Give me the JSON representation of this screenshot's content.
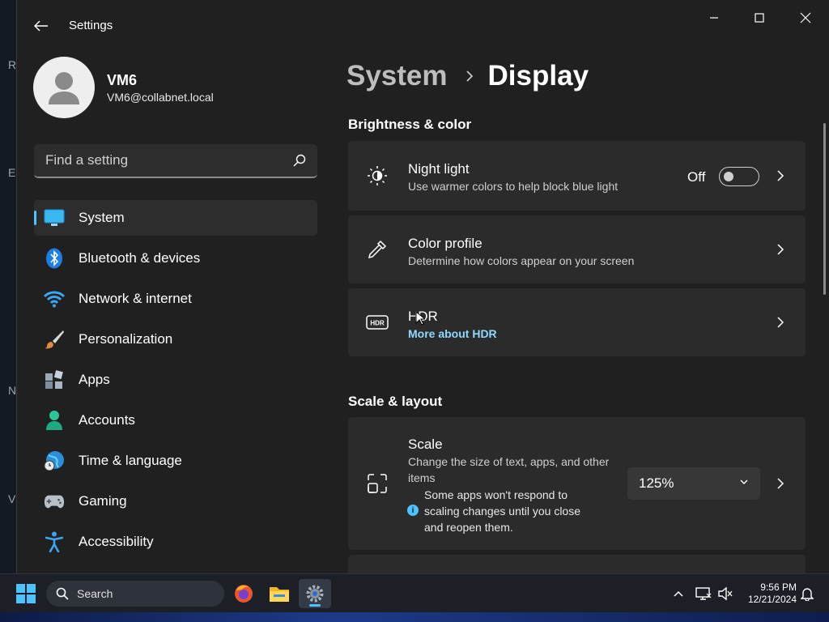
{
  "app": {
    "title": "Settings"
  },
  "profile": {
    "name": "VM6",
    "email": "VM6@collabnet.local"
  },
  "search": {
    "placeholder": "Find a setting"
  },
  "nav": {
    "items": [
      {
        "label": "System",
        "icon": "monitor-icon",
        "active": true
      },
      {
        "label": "Bluetooth & devices",
        "icon": "bluetooth-icon"
      },
      {
        "label": "Network & internet",
        "icon": "wifi-icon"
      },
      {
        "label": "Personalization",
        "icon": "brush-icon"
      },
      {
        "label": "Apps",
        "icon": "apps-icon"
      },
      {
        "label": "Accounts",
        "icon": "person-icon"
      },
      {
        "label": "Time & language",
        "icon": "globe-clock-icon"
      },
      {
        "label": "Gaming",
        "icon": "gamepad-icon"
      },
      {
        "label": "Accessibility",
        "icon": "accessibility-icon"
      }
    ]
  },
  "breadcrumb": {
    "parent": "System",
    "current": "Display"
  },
  "sections": {
    "brightness": {
      "title": "Brightness & color",
      "night_light": {
        "title": "Night light",
        "desc": "Use warmer colors to help block blue light",
        "state": "Off"
      },
      "color_profile": {
        "title": "Color profile",
        "desc": "Determine how colors appear on your screen"
      },
      "hdr": {
        "title": "HDR",
        "link": "More about HDR"
      }
    },
    "scale_layout": {
      "title": "Scale & layout",
      "scale": {
        "title": "Scale",
        "desc": "Change the size of text, apps, and other items",
        "value": "125%",
        "info": "Some apps won't respond to scaling changes until you close and reopen them."
      }
    }
  },
  "taskbar": {
    "search_label": "Search",
    "clock": {
      "time": "9:56 PM",
      "date": "12/21/2024"
    }
  },
  "colors": {
    "accent": "#4cc2ff",
    "window_bg": "#202020",
    "card_bg": "#2b2b2b"
  }
}
